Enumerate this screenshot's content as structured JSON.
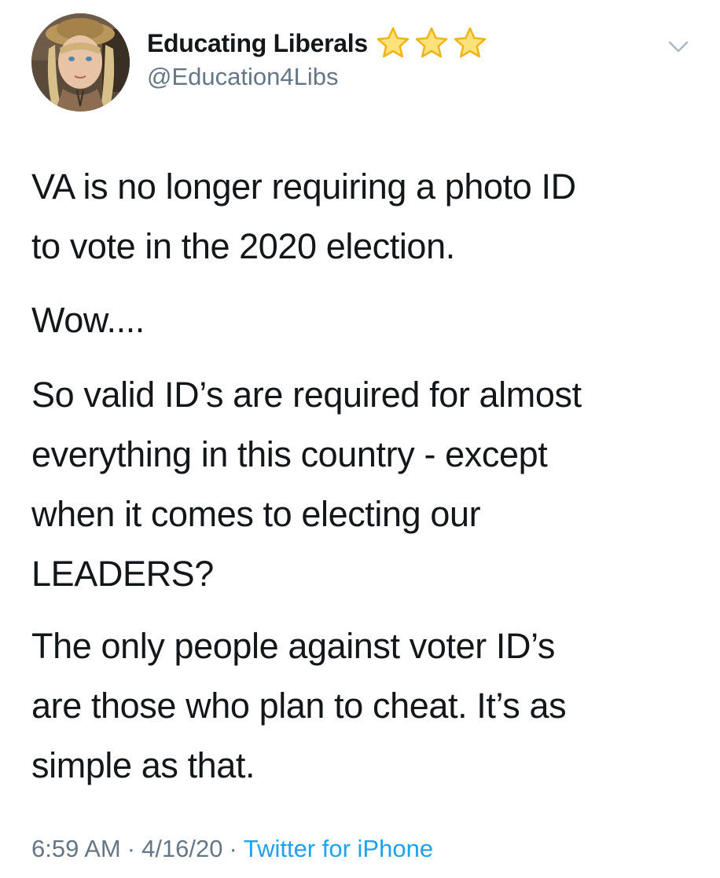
{
  "tweet": {
    "author": {
      "display_name": "Educating Liberals",
      "name_emoji": "⭐⭐⭐",
      "handle": "@Education4Libs"
    },
    "menu_icon": "chevron-down-icon",
    "paragraphs": [
      [
        "VA is no longer requiring a photo ID",
        "to vote in the 2020 election."
      ],
      [
        "Wow...."
      ],
      [
        "So valid ID’s are required for almost",
        "everything in this country - except",
        "when it comes to electing our",
        "LEADERS?"
      ],
      [
        "The only people against voter ID’s",
        "are those who plan to cheat. It’s as",
        "simple as that."
      ]
    ],
    "meta": {
      "time": "6:59 AM",
      "separator": "·",
      "date": "4/16/20",
      "source": "Twitter for iPhone"
    }
  },
  "colors": {
    "text": "#14171a",
    "secondary": "#657786",
    "link": "#1da1f2",
    "star": "#f9c71c"
  }
}
